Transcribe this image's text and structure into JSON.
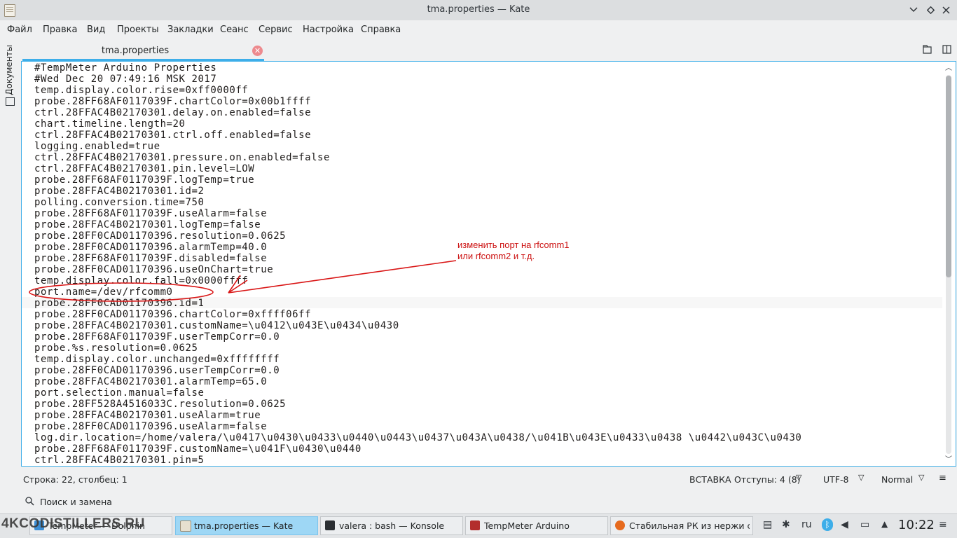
{
  "window": {
    "title": "tma.properties  — Kate"
  },
  "menu": [
    "Файл",
    "Правка",
    "Вид",
    "Проекты",
    "Закладки",
    "Сеанс",
    "Сервис",
    "Настройка",
    "Справка"
  ],
  "side_panel": {
    "label": "Документы"
  },
  "tab": {
    "label": "tma.properties"
  },
  "editor": {
    "lines": [
      "#TempMeter Arduino Properties",
      "#Wed Dec 20 07:49:16 MSK 2017",
      "temp.display.color.rise=0xff0000ff",
      "probe.28FF68AF0117039F.chartColor=0x00b1ffff",
      "ctrl.28FFAC4B02170301.delay.on.enabled=false",
      "chart.timeline.length=20",
      "ctrl.28FFAC4B02170301.ctrl.off.enabled=false",
      "logging.enabled=true",
      "ctrl.28FFAC4B02170301.pressure.on.enabled=false",
      "ctrl.28FFAC4B02170301.pin.level=LOW",
      "probe.28FF68AF0117039F.logTemp=true",
      "probe.28FFAC4B02170301.id=2",
      "polling.conversion.time=750",
      "probe.28FF68AF0117039F.useAlarm=false",
      "probe.28FFAC4B02170301.logTemp=false",
      "probe.28FF0CAD01170396.resolution=0.0625",
      "probe.28FF0CAD01170396.alarmTemp=40.0",
      "probe.28FF68AF0117039F.disabled=false",
      "probe.28FF0CAD01170396.useOnChart=true",
      "temp.display.color.fall=0x0000ffff",
      "port.name=/dev/rfcomm0",
      "probe.28FF0CAD01170396.id=1",
      "probe.28FF0CAD01170396.chartColor=0xffff06ff",
      "probe.28FFAC4B02170301.customName=\\u0412\\u043E\\u0434\\u0430",
      "probe.28FF68AF0117039F.userTempCorr=0.0",
      "probe.%s.resolution=0.0625",
      "temp.display.color.unchanged=0xffffffff",
      "probe.28FF0CAD01170396.userTempCorr=0.0",
      "probe.28FFAC4B02170301.alarmTemp=65.0",
      "port.selection.manual=false",
      "probe.28FF528A4516033C.resolution=0.0625",
      "probe.28FFAC4B02170301.useAlarm=true",
      "probe.28FF0CAD01170396.useAlarm=false",
      "log.dir.location=/home/valera/\\u0417\\u0430\\u0433\\u0440\\u0443\\u0437\\u043A\\u0438/\\u041B\\u043E\\u0433\\u0438 \\u0442\\u043C\\u0430",
      "probe.28FF68AF0117039F.customName=\\u041F\\u0430\\u0440",
      "ctrl.28FFAC4B02170301.pin=5"
    ],
    "annotation": {
      "line1": "изменить порт на rfcomm1",
      "line2": "или rfcomm2 и т.д.",
      "color": "#cc1111"
    }
  },
  "status": {
    "position": "Строка: 22, столбец: 1",
    "mode": "ВСТАВКА",
    "indent": "Отступы: 4 (8)",
    "encoding": "UTF-8",
    "syntax": "Normal"
  },
  "search": {
    "label": "Поиск и замена"
  },
  "taskbar": {
    "tasks": [
      {
        "label": "TempMeter — Dolphin",
        "icon": "folder-icon",
        "color": "#3d8fd6"
      },
      {
        "label": "tma.properties  — Kate",
        "icon": "kate-icon",
        "color": "#e7e0cf"
      },
      {
        "label": "valera : bash — Konsole",
        "icon": "terminal-icon",
        "color": "#2b2f33"
      },
      {
        "label": "TempMeter Arduino",
        "icon": "tempmeter-icon",
        "color": "#b32d2d"
      },
      {
        "label": "Стабильная РК из нержи с на",
        "icon": "firefox-icon",
        "color": "#e66a1e"
      }
    ],
    "tray_lang": "ru",
    "clock": "10:22"
  },
  "watermark": "4KCODISTILLERS.RU"
}
